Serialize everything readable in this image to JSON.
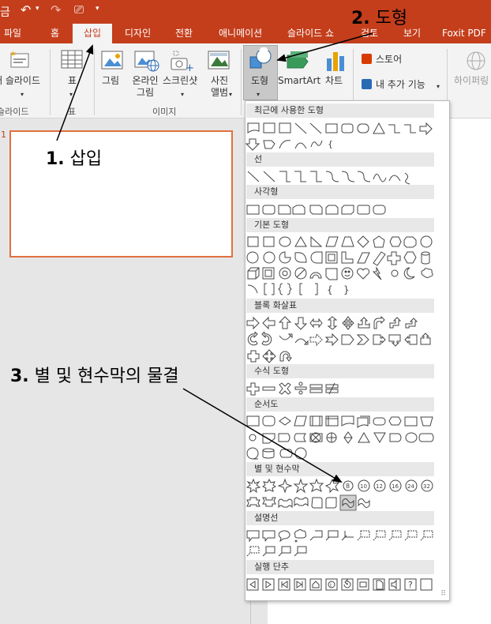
{
  "titlebar": {
    "app_fragment": "금",
    "color": "#c43e1c"
  },
  "tabs": [
    {
      "label": "파일"
    },
    {
      "label": "홈"
    },
    {
      "label": "삽입",
      "active": true
    },
    {
      "label": "디자인"
    },
    {
      "label": "전환"
    },
    {
      "label": "애니메이션"
    },
    {
      "label": "슬라이드 쇼"
    },
    {
      "label": "검토"
    },
    {
      "label": "보기"
    },
    {
      "label": "Foxit PDF"
    }
  ],
  "ribbon": {
    "new_slide": "새 슬라이드",
    "table": "표",
    "pictures": "그림",
    "online_pictures": "온라인 그림",
    "screenshot": "스크린샷",
    "photo_album": "사진 앨범",
    "shapes": "도형",
    "smartart": "SmartArt",
    "chart": "차트",
    "store": "스토어",
    "my_addins": "내 추가 기능",
    "hyperlink": "하이퍼링",
    "groups": {
      "slides": "슬라이드",
      "tables": "표",
      "images": "이미지"
    }
  },
  "shapes_gallery": {
    "sections": [
      {
        "title": "최근에 사용한 도형"
      },
      {
        "title": "선"
      },
      {
        "title": "사각형"
      },
      {
        "title": "기본 도형"
      },
      {
        "title": "블록 화살표"
      },
      {
        "title": "수식 도형"
      },
      {
        "title": "순서도"
      },
      {
        "title": "별 및 현수막"
      },
      {
        "title": "설명선"
      },
      {
        "title": "실행 단추"
      }
    ],
    "selected_shape": "wave"
  },
  "annotations": {
    "step1_num": "1.",
    "step1_text": "삽입",
    "step2_num": "2.",
    "step2_text": "도형",
    "step3_num": "3.",
    "step3_text": "별 및 현수막의 물결"
  },
  "slide_number": "1"
}
